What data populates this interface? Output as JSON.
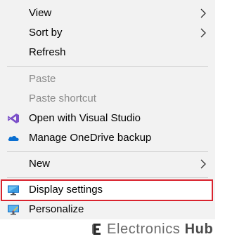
{
  "menu": {
    "view": "View",
    "sort_by": "Sort by",
    "refresh": "Refresh",
    "paste": "Paste",
    "paste_shortcut": "Paste shortcut",
    "open_vs": "Open with Visual Studio",
    "onedrive": "Manage OneDrive backup",
    "new": "New",
    "display_settings": "Display settings",
    "personalize": "Personalize"
  },
  "watermark": {
    "brand_light": "Electronics",
    "brand_bold": "Hub"
  },
  "colors": {
    "menu_bg": "#f2f2f2",
    "highlight_border": "#d9232e",
    "disabled_text": "#8a8a8a",
    "vs_purple": "#7b4fc9",
    "onedrive_blue": "#0a6fd1"
  }
}
